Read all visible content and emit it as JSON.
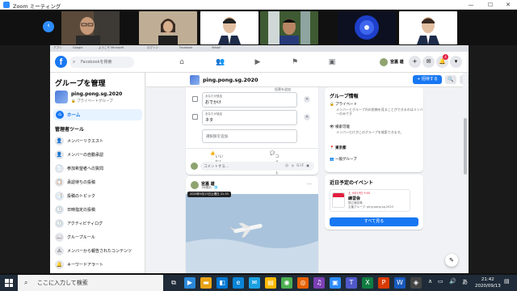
{
  "zoom": {
    "title": "Zoom ミーティング",
    "win_min": "—",
    "win_max": "☐",
    "win_close": "✕",
    "nav_prev": "‹"
  },
  "browser": {
    "bookmarks": [
      "アプリ",
      "Google",
      "ようこそ Microsoft",
      "ログイン",
      "Facebook",
      "Yahoo!"
    ]
  },
  "fb": {
    "search_placeholder": "Facebookを検索",
    "user_name": "宮嘉 雄",
    "notif_count": "4"
  },
  "sidebar": {
    "title": "グループを管理",
    "group_name": "ping.pong.sg.2020",
    "group_type": "🔒 プライベートグループ",
    "home_label": "ホーム",
    "section_title": "管理者ツール",
    "items": [
      {
        "label": "メンバーリクエスト",
        "icon": "👤"
      },
      {
        "label": "メンバーの自動承認",
        "icon": "👤"
      },
      {
        "label": "参加希望者への質問",
        "icon": "📄"
      },
      {
        "label": "承認待ちの投稿",
        "icon": "📋"
      },
      {
        "label": "投稿のトピック",
        "icon": "📑"
      },
      {
        "label": "日時指定の投稿",
        "icon": "🕒"
      },
      {
        "label": "アクティビティログ",
        "icon": "🕒"
      },
      {
        "label": "グループルール",
        "icon": "📖"
      },
      {
        "label": "メンバーから報告されたコンテンツ",
        "icon": "⚠"
      },
      {
        "label": "キーワードアラート",
        "icon": "🔔"
      }
    ]
  },
  "group_header": {
    "name": "ping.pong.sg.2020",
    "invite_label": "+ 招待する",
    "search_icon": "🔍",
    "more_icon": "…"
  },
  "poll": {
    "added_by": "投票を追加",
    "options": [
      {
        "meta": "あなたが追加",
        "text": "おでかけ"
      },
      {
        "meta": "あなたが追加",
        "text": "ネタ"
      }
    ],
    "add_option": "選択肢を追加",
    "like_label": "いいね！",
    "comment_label": "コメント",
    "comment_placeholder": "コメントする…",
    "comment_tools": "☺ ◎ GIF ▣"
  },
  "post2": {
    "author": "宮嘉 雄",
    "meta": "1時間前 · 🌐",
    "more": "…",
    "tooltip": "2020年9月13日土曜日 21:33"
  },
  "info": {
    "title": "グループ情報",
    "privacy": "プライベート",
    "privacy_desc": "メンバーとグループ内の投稿を見ることができるのはメンバーのみです",
    "visibility": "検索可能",
    "visibility_desc": "メンバーだけがこのグループを検索できます。",
    "location": "東京都",
    "category": "一般グループ"
  },
  "events": {
    "title": "近日予定のイベント",
    "date": "土 9月19日 9:00",
    "name": "練習会",
    "location": "国立競技場",
    "group": "主催グループ: ping.pong.sg.2020",
    "see_all": "すべて見る"
  },
  "taskbar": {
    "search_placeholder": "ここに入力して検索",
    "time": "21:42",
    "date": "2020/09/13",
    "ime": "あ",
    "tray_arrow": "∧"
  },
  "colors": {
    "fb_blue": "#1877f2",
    "zoom_blue": "#2d8cff",
    "taskbar": "#1f2b38"
  }
}
